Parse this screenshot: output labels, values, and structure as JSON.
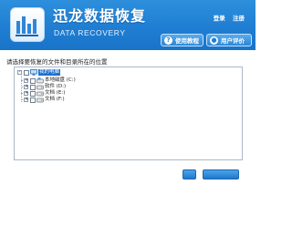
{
  "app": {
    "title_cn": "迅龙数据恢复",
    "title_en": "DATA RECOVERY",
    "top_links": [
      {
        "label": "登录"
      },
      {
        "label": "注册"
      }
    ],
    "buttons": {
      "tutorial": "使用教程",
      "review": "用户评价"
    }
  },
  "main": {
    "instruction": "请选择要恢复的文件和目录所在的位置",
    "tree": {
      "root": {
        "label": "我的电脑",
        "selected": true
      },
      "drives": [
        {
          "label": "本地磁盘 (C:)"
        },
        {
          "label": "软件 (D:)"
        },
        {
          "label": "文档 (E:)"
        },
        {
          "label": "文档 (F:)"
        }
      ]
    }
  },
  "footer": {
    "back_label": "",
    "next_label": ""
  },
  "colors": {
    "header": "#1f7ed3",
    "accent": "#1c6fd1",
    "panel_border": "#a9b8c8"
  }
}
